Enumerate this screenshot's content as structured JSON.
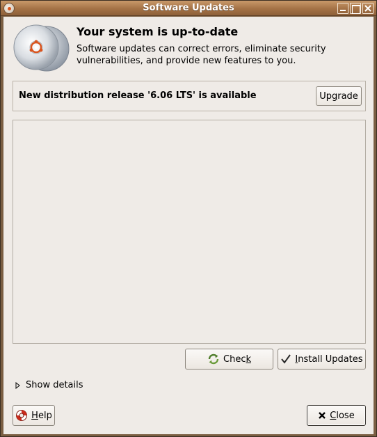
{
  "window": {
    "title": "Software Updates"
  },
  "header": {
    "heading": "Your system is up-to-date",
    "description": "Software updates can correct errors, eliminate security vulnerabilities, and provide new features to you."
  },
  "release": {
    "message": "New distribution release '6.06 LTS' is available",
    "upgrade_pre": "Up",
    "upgrade_mnemonic": "g",
    "upgrade_post": "rade"
  },
  "actions": {
    "check_pre": "Chec",
    "check_mnemonic": "k",
    "install_pre": "",
    "install_mnemonic": "I",
    "install_post": "nstall Updates"
  },
  "details": {
    "label": "Show details"
  },
  "footer": {
    "help_mnemonic": "H",
    "help_post": "elp",
    "close_mnemonic": "C",
    "close_post": "lose"
  },
  "icons": {
    "hero": "cd-disc-ubuntu-icon",
    "check": "refresh-icon",
    "install": "checkmark-icon",
    "help": "lifebuoy-icon",
    "close": "close-x-icon",
    "expander": "triangle-right-icon"
  },
  "colors": {
    "titlebar": "#a47246",
    "window_bg": "#efebe7",
    "accent": "#d9541e"
  }
}
